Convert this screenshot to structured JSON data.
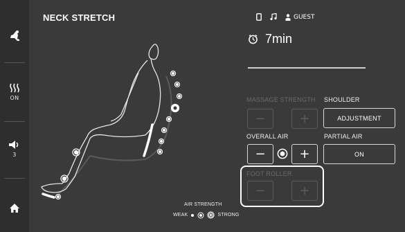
{
  "title": "NECK STRETCH",
  "header": {
    "user_label": "GUEST",
    "icons": [
      "phone-icon",
      "music-note-icon",
      "user-icon"
    ]
  },
  "sidebar": {
    "items": [
      {
        "icon": "chair-icon",
        "label": ""
      },
      {
        "icon": "heat-icon",
        "label": "ON"
      },
      {
        "icon": "volume-icon",
        "label": "3"
      },
      {
        "icon": "home-icon",
        "label": ""
      }
    ]
  },
  "timer": {
    "icon": "timer-icon",
    "value": "7min"
  },
  "controls": {
    "massage_strength": {
      "label": "MASSAGE STRENGTH",
      "minus": "−",
      "plus": "+",
      "enabled": false
    },
    "shoulder": {
      "label": "SHOULDER",
      "button": "ADJUSTMENT"
    },
    "overall_air": {
      "label": "OVERALL AIR",
      "minus": "−",
      "plus": "+",
      "enabled": true
    },
    "partial_air": {
      "label": "PARTIAL AIR",
      "button": "ON"
    },
    "foot_roller": {
      "label": "FOOT ROLLER",
      "minus": "−",
      "plus": "+",
      "enabled": false
    }
  },
  "air_strength": {
    "title": "AIR STRENGTH",
    "weak_label": "WEAK",
    "strong_label": "STRONG"
  },
  "colors": {
    "background": "#3a3a3a",
    "sidebar": "#2e2e2e",
    "foreground": "#ffffff",
    "dim": "#6a6a6a"
  }
}
